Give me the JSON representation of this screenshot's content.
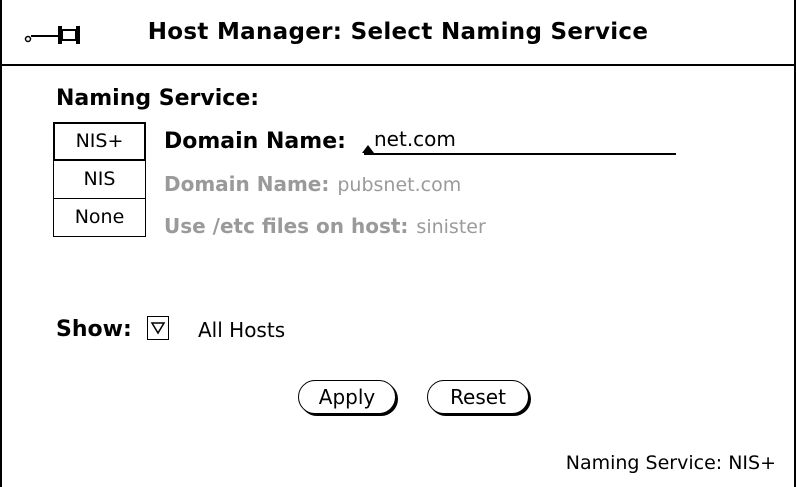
{
  "window": {
    "title": "Host Manager: Select Naming Service"
  },
  "naming_service": {
    "label": "Naming Service:",
    "choices": [
      {
        "label": "NIS+",
        "selected": true
      },
      {
        "label": "NIS",
        "selected": false
      },
      {
        "label": "None",
        "selected": false
      }
    ],
    "nisplus_row": {
      "label": "Domain Name:",
      "value": "net.com"
    },
    "nis_row": {
      "label": "Domain Name:",
      "value": "pubsnet.com"
    },
    "none_row": {
      "label": "Use /etc files on host:",
      "value": "sinister"
    }
  },
  "show": {
    "label": "Show:",
    "value": "All Hosts",
    "menu_icon": "triangle-down-icon"
  },
  "buttons": {
    "apply": "Apply",
    "reset": "Reset"
  },
  "footer": {
    "status": "Naming Service: NIS+"
  },
  "colors": {
    "foreground": "#000000",
    "background": "#ffffff",
    "inactive_text": "#9a9a9a"
  }
}
